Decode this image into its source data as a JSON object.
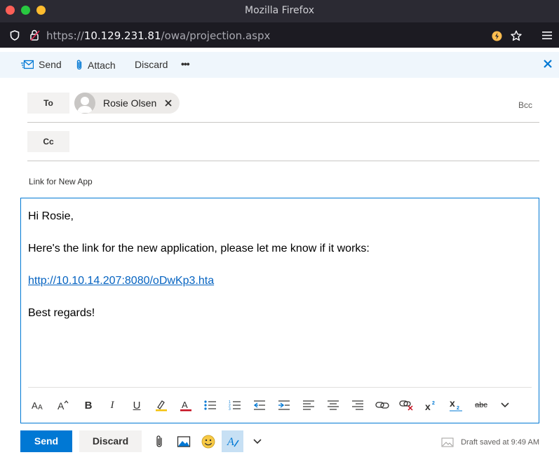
{
  "browser": {
    "window_title": "Mozilla Firefox",
    "url_prefix": "https://",
    "url_host": "10.129.231.81",
    "url_path": "/owa/projection.aspx"
  },
  "command_bar": {
    "send_label": "Send",
    "attach_label": "Attach",
    "discard_label": "Discard",
    "more_label": "•••"
  },
  "header": {
    "to_label": "To",
    "cc_label": "Cc",
    "bcc_label": "Bcc",
    "recipients": [
      {
        "name": "Rosie Olsen"
      }
    ],
    "subject": "Link for New App"
  },
  "body": {
    "greeting": "Hi Rosie,",
    "line1": "Here's the link for the new application, please let me know if it works:",
    "link": "http://10.10.14.207:8080/oDwKp3.hta",
    "closing": "Best regards!"
  },
  "format_toolbar": {
    "icons": [
      "font-size-icon",
      "font-grow-icon",
      "bold-icon",
      "italic-icon",
      "underline-icon",
      "highlight-icon",
      "font-color-icon",
      "bullets-icon",
      "numbering-icon",
      "decrease-indent-icon",
      "increase-indent-icon",
      "align-left-icon",
      "align-center-icon",
      "align-right-icon",
      "insert-link-icon",
      "remove-link-icon",
      "superscript-icon",
      "subscript-icon",
      "strikethrough-icon",
      "chevron-down-icon"
    ],
    "bold_glyph": "B",
    "italic_glyph": "I",
    "underline_glyph": "U",
    "strike_glyph": "abc"
  },
  "footer": {
    "send_label": "Send",
    "discard_label": "Discard",
    "draft_status": "Draft saved at 9:49 AM"
  },
  "colors": {
    "accent": "#0078d4",
    "command_bar_bg": "#eff6fc",
    "link": "#0563c1"
  }
}
